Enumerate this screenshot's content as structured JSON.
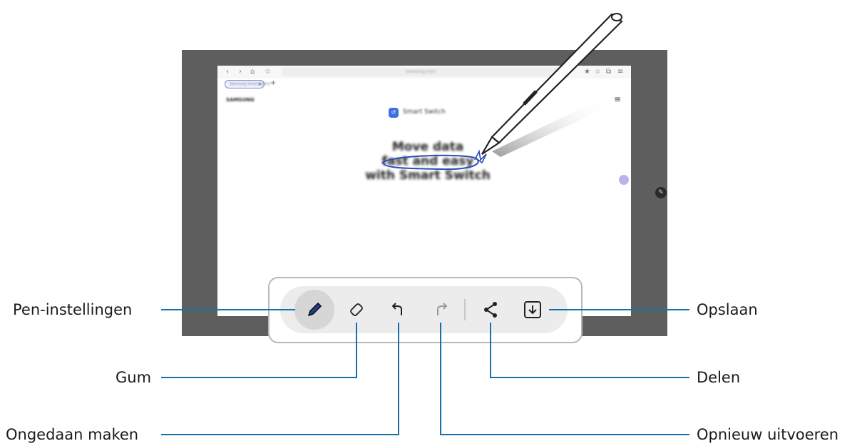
{
  "browser": {
    "url": "samsung.com",
    "tab_label": "Samsung Smart Switch",
    "nav_icons": [
      "‹",
      "›",
      "⌂",
      "☆"
    ],
    "right_icons": [
      "★",
      "☆",
      "⧉",
      "≡"
    ],
    "new_tab": "+",
    "tab_close": "×"
  },
  "page": {
    "brand": "SAMSUNG",
    "menu": "≡",
    "logo_glyph": "↺",
    "logo_text": "Smart Switch",
    "headline": [
      "Move data",
      "fast and easy",
      "with Smart Switch"
    ]
  },
  "toolbar": {
    "buttons": [
      "pen-settings",
      "eraser",
      "undo",
      "redo",
      "share",
      "save"
    ],
    "accent": "#1a6fa8"
  },
  "callouts": {
    "pen_settings": "Pen-instellingen",
    "eraser": "Gum",
    "undo": "Ongedaan maken",
    "save": "Opslaan",
    "share": "Delen",
    "redo": "Opnieuw uitvoeren"
  }
}
